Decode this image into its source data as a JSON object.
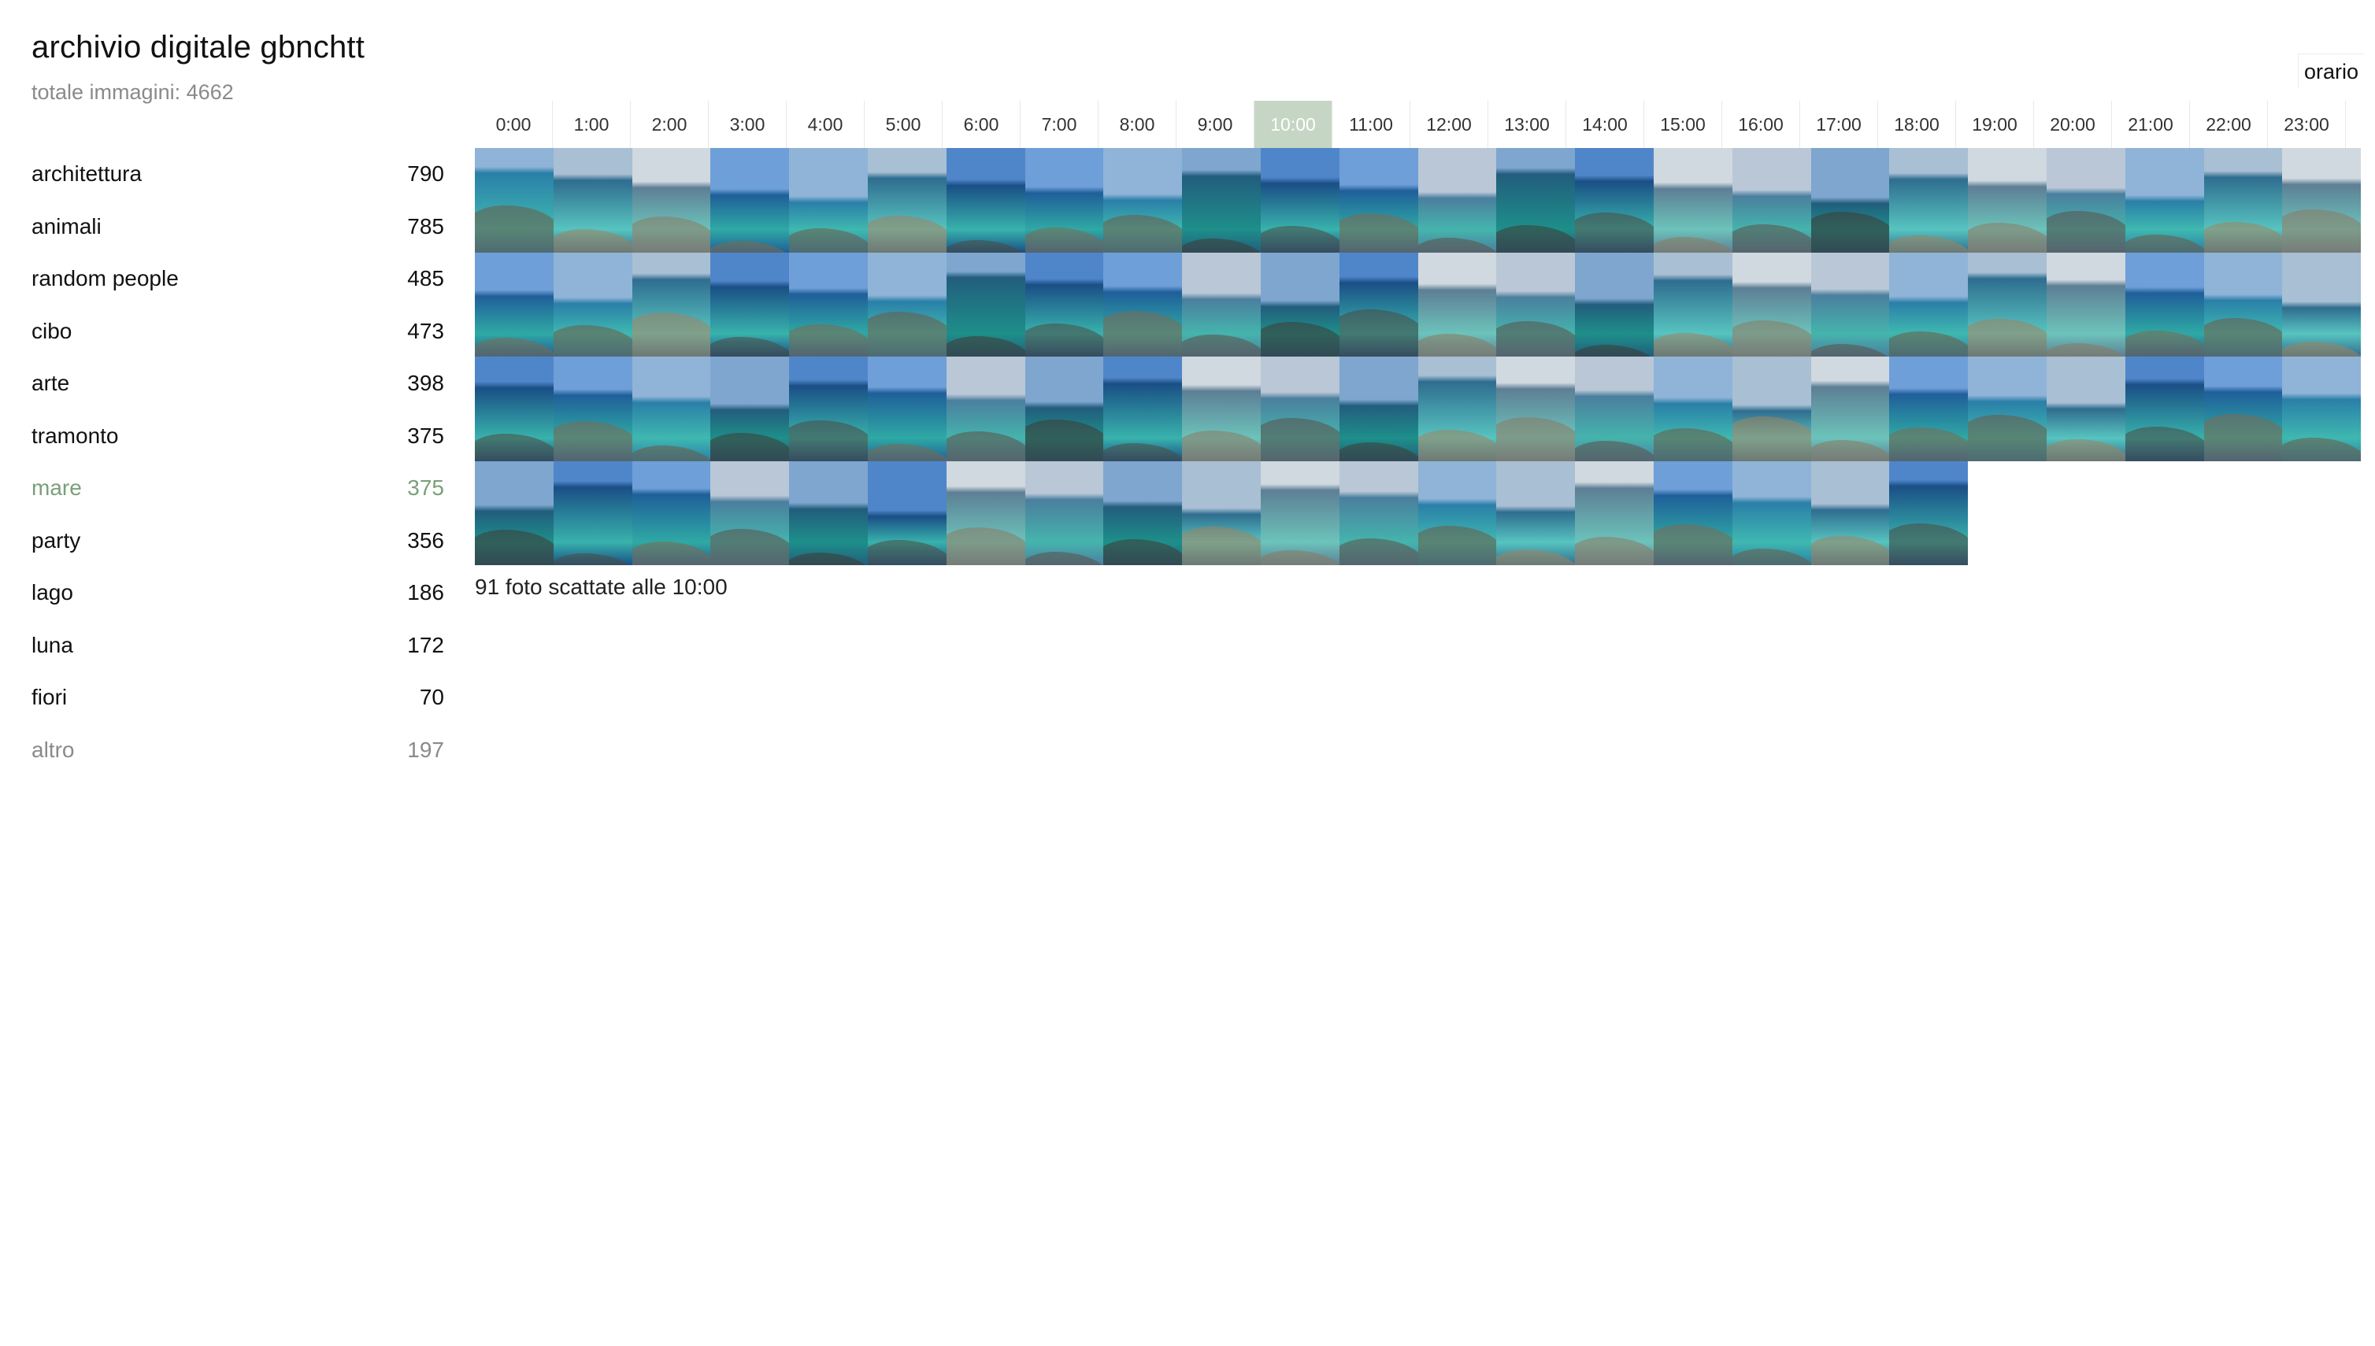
{
  "header": {
    "title": "archivio digitale gbnchtt",
    "total": "totale immagini: 4662"
  },
  "view_toggle": "orario",
  "categories": [
    {
      "label": "architettura",
      "count": "790",
      "state": "normal"
    },
    {
      "label": "animali",
      "count": "785",
      "state": "normal"
    },
    {
      "label": "random people",
      "count": "485",
      "state": "normal"
    },
    {
      "label": "cibo",
      "count": "473",
      "state": "normal"
    },
    {
      "label": "arte",
      "count": "398",
      "state": "normal"
    },
    {
      "label": "tramonto",
      "count": "375",
      "state": "normal"
    },
    {
      "label": "mare",
      "count": "375",
      "state": "active"
    },
    {
      "label": "party",
      "count": "356",
      "state": "normal"
    },
    {
      "label": "lago",
      "count": "186",
      "state": "normal"
    },
    {
      "label": "luna",
      "count": "172",
      "state": "normal"
    },
    {
      "label": "fiori",
      "count": "70",
      "state": "normal"
    },
    {
      "label": "altro",
      "count": "197",
      "state": "other"
    }
  ],
  "hours": [
    "0:00",
    "1:00",
    "2:00",
    "3:00",
    "4:00",
    "5:00",
    "6:00",
    "7:00",
    "8:00",
    "9:00",
    "10:00",
    "11:00",
    "12:00",
    "13:00",
    "14:00",
    "15:00",
    "16:00",
    "17:00",
    "18:00",
    "19:00",
    "20:00",
    "21:00",
    "22:00",
    "23:00"
  ],
  "selected_hour": "10:00",
  "caption": "91 foto scattate alle 10:00",
  "photo_count_shown": 91,
  "colors": {
    "accent": "#7aa07a",
    "active_hour_bg": "#c6d6c4",
    "muted": "#8a8a8a"
  }
}
